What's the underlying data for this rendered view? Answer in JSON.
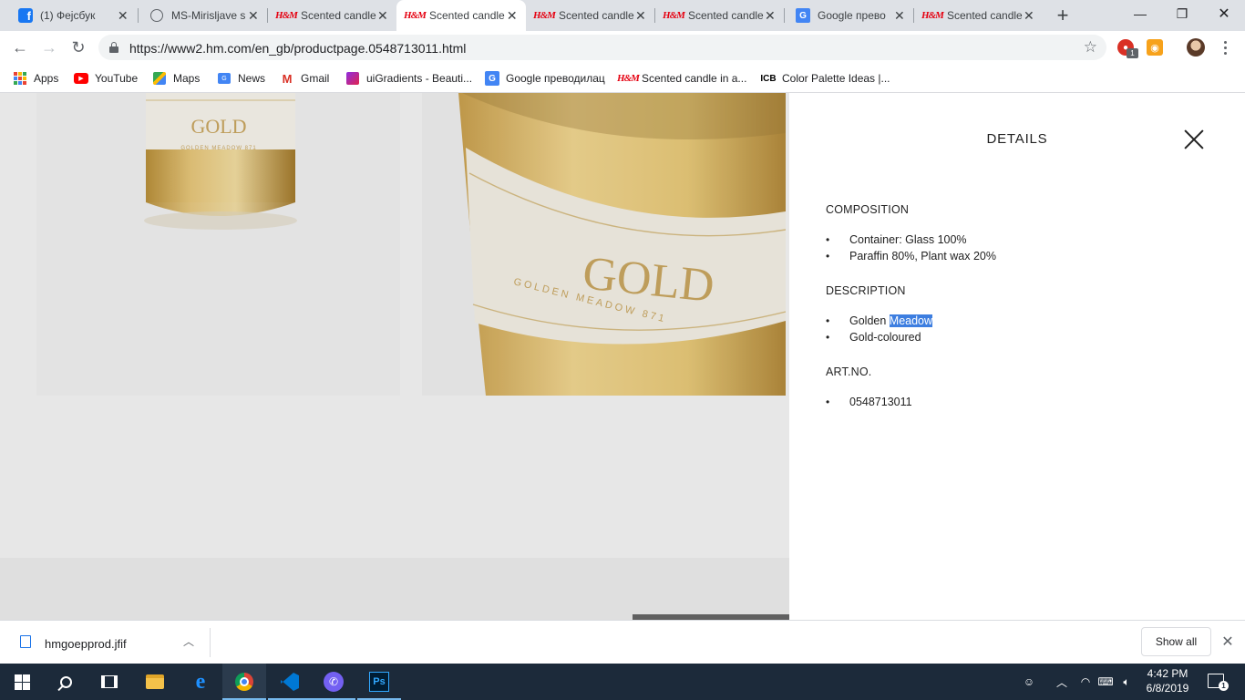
{
  "browser": {
    "tabs": [
      {
        "title": "(1) Фејсбук",
        "favicon": "facebook-icon"
      },
      {
        "title": "MS-Mirisljave s",
        "favicon": "globe-icon"
      },
      {
        "title": "Scented candle",
        "favicon": "hm-icon"
      },
      {
        "title": "Scented candle",
        "favicon": "hm-icon",
        "active": true
      },
      {
        "title": "Scented candle",
        "favicon": "hm-icon"
      },
      {
        "title": "Scented candle",
        "favicon": "hm-icon"
      },
      {
        "title": "Google прево",
        "favicon": "google-translate-icon"
      },
      {
        "title": "Scented candle",
        "favicon": "hm-icon"
      }
    ],
    "url": "https://www2.hm.com/en_gb/productpage.0548713011.html",
    "extension_badge": "1",
    "hm_logo_text": "H&M",
    "bookmarks": [
      {
        "label": "Apps",
        "icon": "apps-grid-icon"
      },
      {
        "label": "YouTube",
        "icon": "youtube-icon"
      },
      {
        "label": "Maps",
        "icon": "maps-icon"
      },
      {
        "label": "News",
        "icon": "news-icon"
      },
      {
        "label": "Gmail",
        "icon": "gmail-icon"
      },
      {
        "label": "uiGradients - Beauti...",
        "icon": "uigradients-icon"
      },
      {
        "label": "Google преводилац",
        "icon": "google-translate-icon"
      },
      {
        "label": "Scented candle in a...",
        "icon": "hm-icon"
      },
      {
        "label": "Color Palette Ideas |...",
        "icon": "icb-icon"
      }
    ]
  },
  "product": {
    "label_brand": "GOLD",
    "label_sub": "GOLDEN MEADOW 871"
  },
  "details": {
    "title": "DETAILS",
    "composition_heading": "COMPOSITION",
    "composition": [
      "Container: Glass 100%",
      "Paraffin 80%, Plant wax 20%"
    ],
    "description_heading": "DESCRIPTION",
    "description_1_plain": "Golden ",
    "description_1_selected": "Meadow",
    "description_2": "Gold-coloured",
    "artno_heading": "ART.NO.",
    "artno": "0548713011"
  },
  "downloads": {
    "file_name": "hmgoepprod.jfif",
    "show_all_label": "Show all"
  },
  "taskbar": {
    "time": "4:42 PM",
    "date": "6/8/2019",
    "notification_count": "1",
    "ps_label": "Ps",
    "apps": [
      "windows-start",
      "search",
      "task-view",
      "file-explorer",
      "edge",
      "chrome",
      "vscode",
      "viber",
      "photoshop"
    ]
  },
  "colors": {
    "hm_red": "#e50010",
    "selection_blue": "#3d7ee0",
    "taskbar_bg": "#1c2a3a"
  }
}
